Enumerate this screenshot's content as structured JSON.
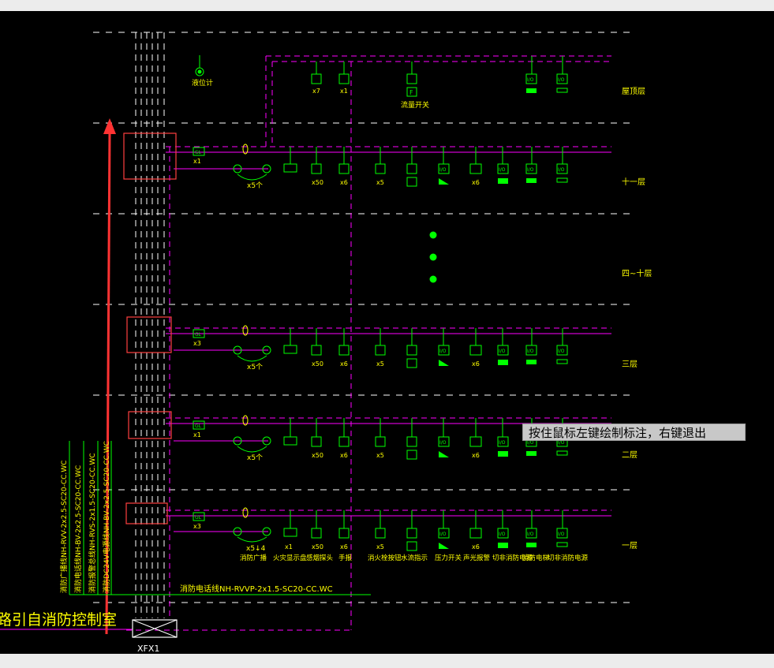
{
  "title": "",
  "colors": {
    "background": "#000000",
    "floor_line": "#ffffff",
    "bus": "#ff00ff",
    "device": "#00ff00",
    "label": "#ffff00",
    "marker_box": "#ff4040",
    "arrow": "#ff3333"
  },
  "floors": {
    "roof": "屋顶层",
    "f11": "十一层",
    "f4_10": "四~十层",
    "f3": "三层",
    "f2": "二层",
    "f1": "一层"
  },
  "roof_devices": {
    "level_gauge": "液位计",
    "flow_switch": "流量开关",
    "count_x7": "x7",
    "count_x1": "x1"
  },
  "column": {
    "bus_tag": "GL",
    "count_x1": "x1",
    "count_x3": "x3",
    "hydrant_label": "x5个",
    "hydrant_label_f1": "x5↓4"
  },
  "device_counts": {
    "c_x1": "x1",
    "c_x50": "x50",
    "c_x6": "x6",
    "c_x5": "x5"
  },
  "bottom_labels": {
    "broadcast": "消防广播",
    "fire_display": "火灾显示盘",
    "smoke_detector": "感烟探头",
    "manual": "手报",
    "hydrant_button": "消火栓按钮",
    "water_flow": "水流指示",
    "pressure_switch": "压力开关",
    "sound_light": "声光报警",
    "nonfire_power": "切非消防电源",
    "fire_elevator": "消防电梯",
    "cut_power": "切非消防电源"
  },
  "device_box_labels": {
    "io": "I/O",
    "input": "I",
    "flow": "F"
  },
  "cable_labels": {
    "c1": "消防广播线NH-RVV-2x2.5-SC20-CC.WC",
    "c2": "消防电话线NH-BV-2x2.5-SC20-CC.WC",
    "c3": "消防报警总线NH-RVS-2x1.5-SC20-CC.WC",
    "c4": "消防DC24V电源线NH-BV-2x2.5-SC20-CC.WC",
    "main": "消防电话线NH-RVVP-2x1.5-SC20-CC.WC"
  },
  "source_label": "路引自消防控制室",
  "panel_label": "XFX1",
  "status_tooltip": "按住鼠标左键绘制标注，右键退出"
}
